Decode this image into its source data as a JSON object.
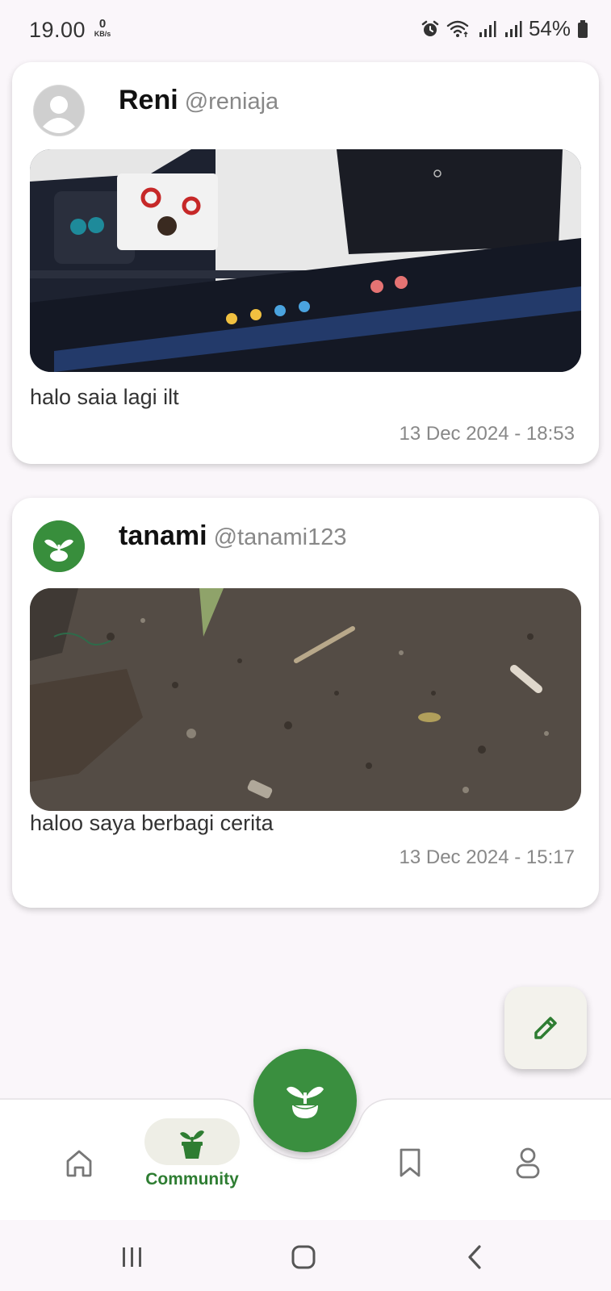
{
  "status_bar": {
    "time": "19.00",
    "net_speed_value": "0",
    "net_speed_unit": "KB/s",
    "battery": "54%"
  },
  "posts": [
    {
      "author_name": "Reni",
      "author_handle": "@reniaja",
      "avatar_icon": "person-placeholder-icon",
      "image_desc_icon": "laptop-screen-photo",
      "text": "halo saia lagi ilt",
      "date": "13 Dec 2024 - 18:53"
    },
    {
      "author_name": "tanami",
      "author_handle": "@tanami123",
      "avatar_icon": "sprout-logo-icon",
      "image_desc_icon": "soil-ground-photo",
      "text": "haloo saya berbagi cerita",
      "date": "13 Dec 2024 - 15:17"
    }
  ],
  "bottom_nav": {
    "items": [
      {
        "icon": "home-icon",
        "label": ""
      },
      {
        "icon": "plant-pot-icon",
        "label": "Community",
        "active": true
      },
      {
        "icon": "bookmark-icon",
        "label": ""
      },
      {
        "icon": "profile-icon",
        "label": ""
      }
    ],
    "center_icon": "sprout-icon"
  },
  "colors": {
    "accent_green": "#388e3c",
    "background": "#faf6fa",
    "card": "#ffffff",
    "muted_text": "#888888"
  }
}
